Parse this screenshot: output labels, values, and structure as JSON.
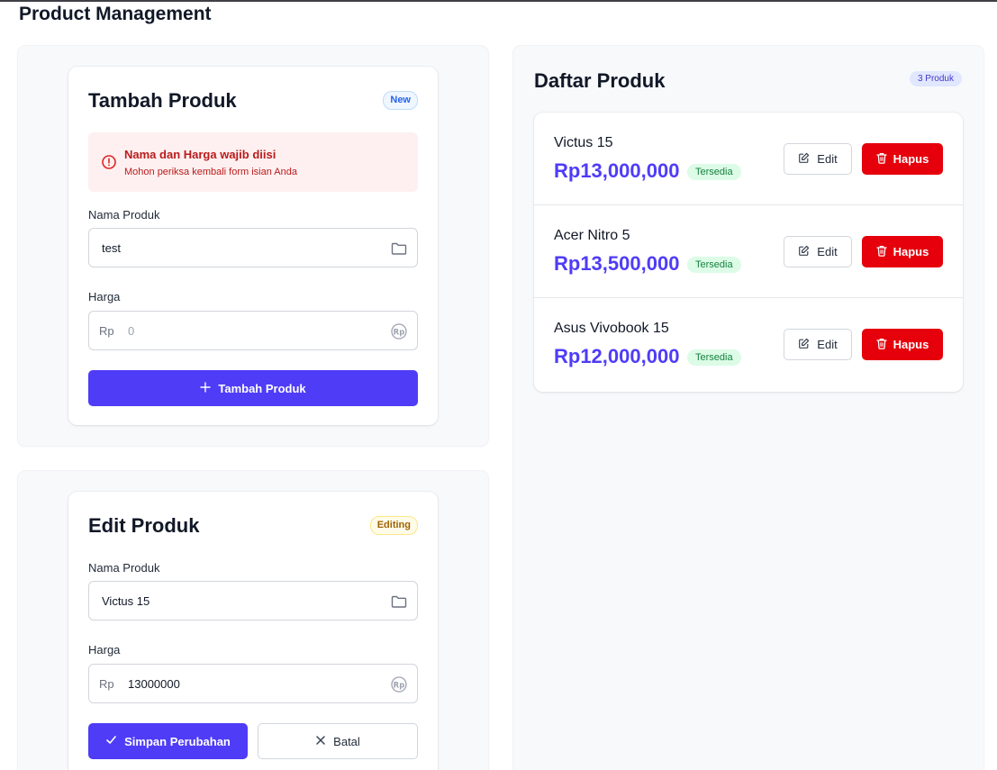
{
  "page": {
    "title": "Product Management"
  },
  "add_form": {
    "title": "Tambah Produk",
    "badge": "New",
    "alert": {
      "title": "Nama dan Harga wajib diisi",
      "message": "Mohon periksa kembali form isian Anda"
    },
    "name_label": "Nama Produk",
    "name_value": "test",
    "price_label": "Harga",
    "price_prefix": "Rp",
    "price_value": "0",
    "submit_label": "Tambah Produk"
  },
  "edit_form": {
    "title": "Edit Produk",
    "badge": "Editing",
    "name_label": "Nama Produk",
    "name_value": "Victus 15",
    "price_label": "Harga",
    "price_prefix": "Rp",
    "price_value": "13000000",
    "save_label": "Simpan Perubahan",
    "cancel_label": "Batal"
  },
  "product_list": {
    "title": "Daftar Produk",
    "count_badge": "3 Produk",
    "edit_label": "Edit",
    "delete_label": "Hapus",
    "items": [
      {
        "name": "Victus 15",
        "price": "Rp13,000,000",
        "status": "Tersedia"
      },
      {
        "name": "Acer Nitro 5",
        "price": "Rp13,500,000",
        "status": "Tersedia"
      },
      {
        "name": "Asus Vivobook 15",
        "price": "Rp12,000,000",
        "status": "Tersedia"
      }
    ]
  },
  "colors": {
    "primary": "#4f3cf7",
    "danger": "#e5000b",
    "success_text": "#15803d",
    "success_bg": "#dcfce7",
    "error_text": "#b91c1c",
    "error_bg": "#fef0f0"
  },
  "icons": [
    "alert-circle-icon",
    "folder-icon",
    "rupiah-icon",
    "plus-icon",
    "check-icon",
    "close-icon",
    "pencil-square-icon",
    "trash-icon"
  ]
}
